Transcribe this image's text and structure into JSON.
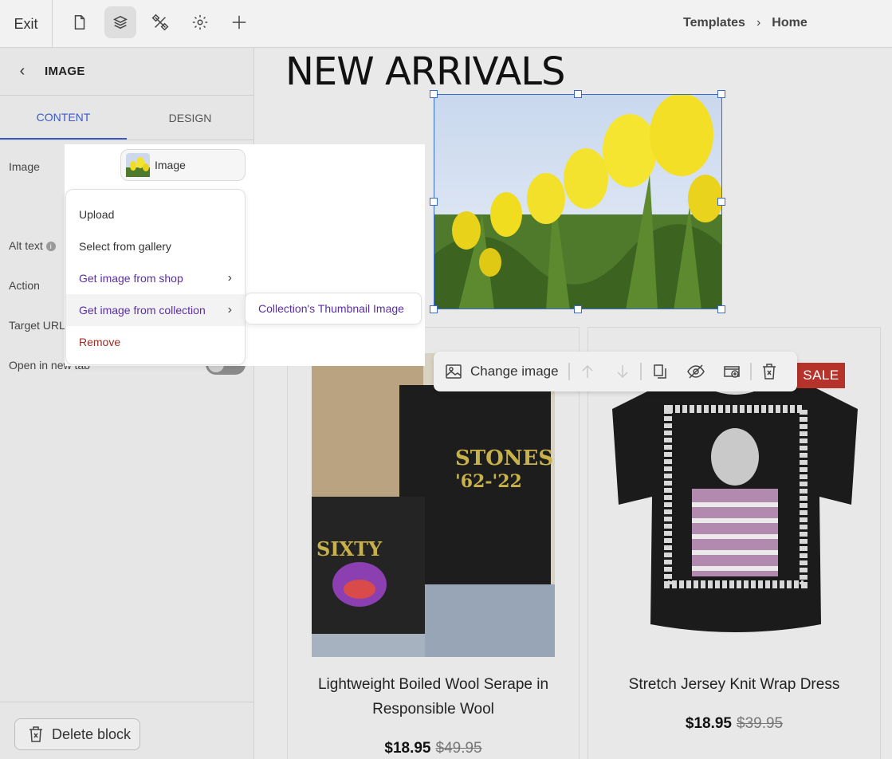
{
  "topbar": {
    "exit_label": "Exit",
    "icons": [
      "page-icon",
      "layers-icon",
      "tools-icon",
      "gear-icon",
      "plus-icon"
    ],
    "breadcrumb": [
      "Templates",
      "Home"
    ]
  },
  "panel": {
    "title": "IMAGE",
    "tabs": [
      "CONTENT",
      "DESIGN"
    ],
    "fields": {
      "image": "Image",
      "alt_text": "Alt text",
      "action": "Action",
      "target_url": "Target URL",
      "open_new_tab": "Open in new tab"
    },
    "delete_label": "Delete block"
  },
  "picker": {
    "pill_label": "Image",
    "menu": [
      "Upload",
      "Select from gallery",
      "Get image from shop",
      "Get image from collection",
      "Remove"
    ],
    "submenu": "Collection's Thumbnail Image"
  },
  "canvas": {
    "heading": "NEW ARRIVALS",
    "toolbar": {
      "change_image": "Change image"
    },
    "products": [
      {
        "title": "Lightweight Boiled Wool Serape in Responsible Wool",
        "price": "$18.95",
        "compare_price": "$49.95"
      },
      {
        "title": "Stretch Jersey Knit Wrap Dress",
        "price": "$18.95",
        "compare_price": "$39.95",
        "badge": "SALE"
      }
    ]
  },
  "colors": {
    "accent": "#3a59c8",
    "link": "#5a2ea6",
    "danger": "#9b2a22",
    "sale": "#b5332b"
  }
}
